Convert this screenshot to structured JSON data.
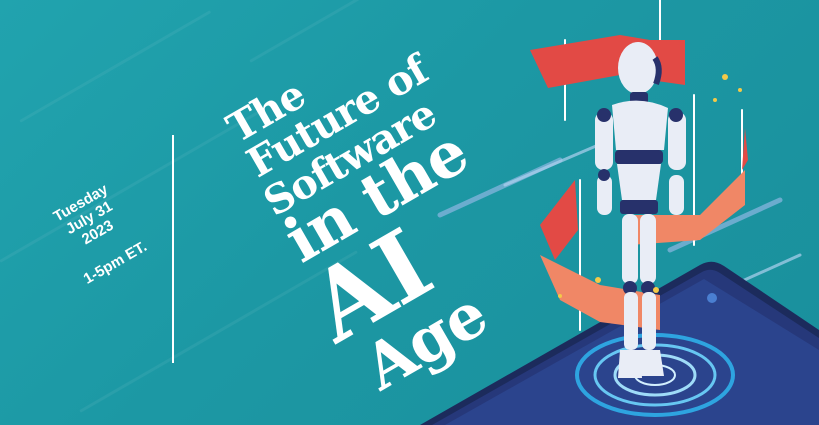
{
  "event": {
    "day": "Tuesday",
    "month_day": "July 31",
    "year": "2023",
    "time": "1-5pm ET."
  },
  "title": {
    "line1": "The",
    "line2": "Future of",
    "line3": "Software",
    "line4": "in the",
    "line5": "AI",
    "line6": "Age"
  },
  "colors": {
    "background": "#1f9aa6",
    "accent_red": "#e24a45",
    "accent_salmon": "#f08766",
    "phone_navy": "#1f2f66",
    "robot_body": "#e9edf6",
    "robot_joint": "#27316b"
  },
  "icons": [
    "robot-illustration",
    "smartphone-illustration",
    "hologram-ring"
  ]
}
